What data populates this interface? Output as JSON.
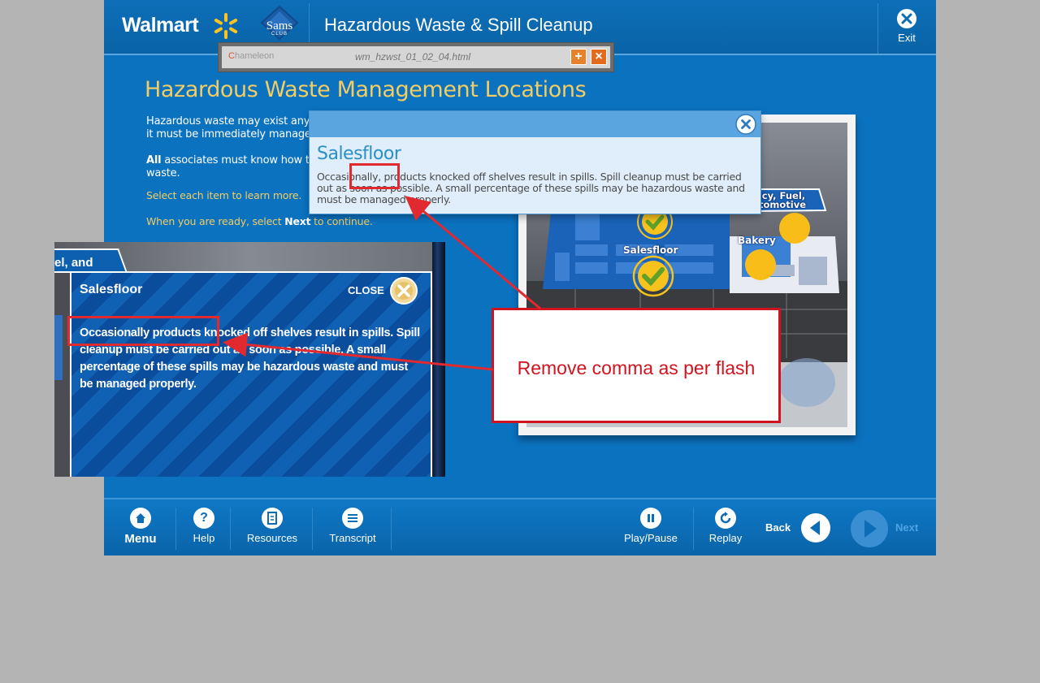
{
  "header": {
    "brand": "Walmart",
    "sams_logo_text": "Sams",
    "sams_logo_sub": "CLUB",
    "course_title": "Hazardous Waste & Spill Cleanup",
    "exit_label": "Exit"
  },
  "page": {
    "heading": "Hazardous Waste Management Locations",
    "intro_line1": "Hazardous waste may exist anyw",
    "intro_line2": "it must be immediately manage",
    "intro2_bold": "All",
    "intro2_rest": " associates must know how to",
    "intro2_line2": "waste.",
    "instruction1": "Select each item to learn more.",
    "instruction2_pre": "When you are ready, select ",
    "instruction2_bold": "Next",
    "instruction2_post": " to continue."
  },
  "map": {
    "labels": {
      "pharmacy": "acy, Fuel,",
      "automotive": "tomotive",
      "bakery": "Bakery",
      "salesfloor": "Salesfloor"
    },
    "colors": {
      "visited": "#f7c21c",
      "check": "#5ea02a",
      "hotspot": "#f9bd1a"
    }
  },
  "chameleon": {
    "logo_c": "C",
    "logo_rest": "hameleon",
    "filename": "wm_hzwst_01_02_04.html",
    "add_glyph": "+",
    "close_glyph": "×"
  },
  "popup": {
    "title": "Salesfloor",
    "body": "Occasionally, products knocked off shelves result in spills.  Spill cleanup must be carried out as soon as possible.  A small percentage of these spills may be hazardous waste and must be managed properly."
  },
  "flash": {
    "tab_text": "el, and",
    "title": "Salesfloor",
    "close_label": "CLOSE",
    "body": "Occasionally products knocked off shelves result in spills.  Spill cleanup must be carried out as soon as possible.  A small percentage of these spills may be hazardous waste and must be managed properly."
  },
  "annotation": {
    "text": "Remove comma as per flash",
    "color": "#d0141f"
  },
  "nav": {
    "menu": "Menu",
    "help": "Help",
    "help_glyph": "?",
    "resources": "Resources",
    "transcript": "Transcript",
    "playpause": "Play/Pause",
    "replay": "Replay",
    "back": "Back",
    "next": "Next"
  }
}
